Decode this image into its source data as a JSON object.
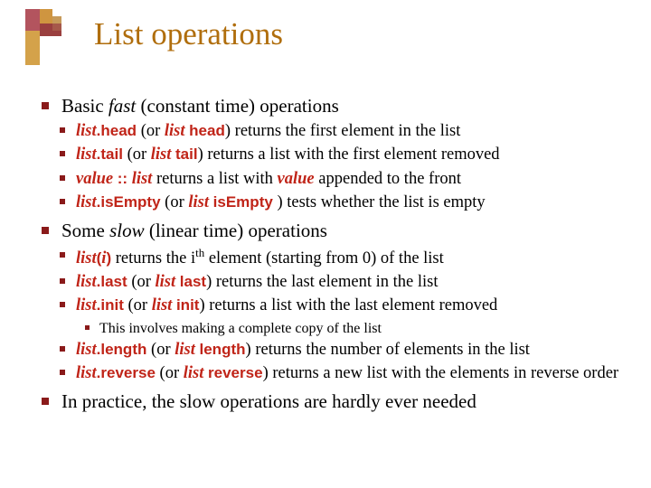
{
  "title": "List operations",
  "bullets": {
    "top1": "Basic <i>fast</i> (constant time) operations",
    "top2": "Some <i>slow</i> (linear time) operations",
    "top3": "In practice, the slow operations are hardly ever needed",
    "fast": {
      "head": "<span class='kw'>list</span><span class='kw mono'>.head</span> (or <span class='kw'>list</span> <span class='kw mono'>head</span>) returns the first element in the list",
      "tail": "<span class='kw'>list</span><span class='kw mono'>.tail</span> (or <span class='kw'>list</span> <span class='kw mono'>tail</span>) returns a list with the first element removed",
      "cons": "<span class='kw'>value</span> <span class='kw mono'>::</span> <span class='kw'>list</span> returns a list with <span class='kw'>value</span> appended to the front",
      "isEmpty": "<span class='kw'>list</span><span class='kw mono'>.isEmpty</span> (or <span class='kw'>list</span> <span class='kw mono'>isEmpty</span> ) tests whether the list is empty"
    },
    "slow": {
      "apply": "<span class='kw'>list</span><span class='kw mono'>(</span><span class='kw'>i</span><span class='kw mono'>)</span> returns the i<sup>th</sup> element (starting from 0) of the list",
      "last": "<span class='kw'>list</span><span class='kw mono'>.last</span> (or <span class='kw'>list</span> <span class='kw mono'>last</span>) returns the last element in the list",
      "init": "<span class='kw'>list</span><span class='kw mono'>.init</span> (or <span class='kw'>list</span> <span class='kw mono'>init</span>) returns a list with the last element removed",
      "initNote": "This involves making a complete copy of the list",
      "length": "<span class='kw'>list</span><span class='kw mono'>.length</span> (or <span class='kw'>list</span> <span class='kw mono'>length</span>) returns the number of elements in the list",
      "reverse": "<span class='kw'>list</span><span class='kw mono'>.reverse</span> (or <span class='kw'>list</span> <span class='kw mono'>reverse</span>) returns a new list with the elements in reverse order"
    }
  }
}
